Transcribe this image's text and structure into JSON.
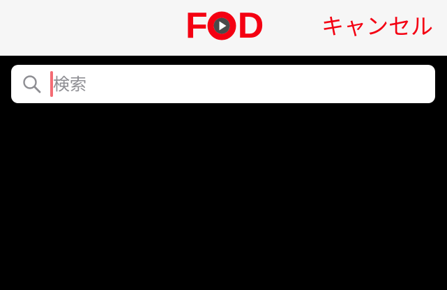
{
  "navbar": {
    "logo_text": "FOD",
    "logo_letter_f": "F",
    "logo_letter_d": "D",
    "cancel_label": "キャンセル"
  },
  "search": {
    "placeholder": "検索",
    "value": "",
    "icon": "search-icon"
  },
  "colors": {
    "brand_red": "#f40012",
    "navbar_bg": "#f6f6f6",
    "content_bg": "#000000",
    "placeholder": "#8e8e93",
    "caret": "#f46b73"
  }
}
